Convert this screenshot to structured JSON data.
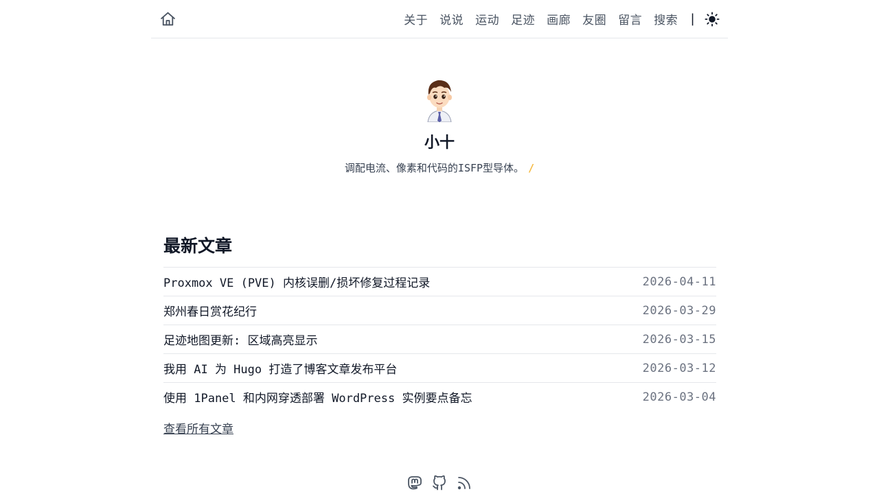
{
  "header": {
    "home_icon": "home-icon",
    "nav": [
      {
        "label": "关于"
      },
      {
        "label": "说说"
      },
      {
        "label": "运动"
      },
      {
        "label": "足迹"
      },
      {
        "label": "画廊"
      },
      {
        "label": "友圈"
      },
      {
        "label": "留言"
      },
      {
        "label": "搜索"
      }
    ],
    "separator": "|",
    "theme_icon": "sun-icon"
  },
  "profile": {
    "name": "小十",
    "bio": "调配电流、像素和代码的ISFP型导体。",
    "cursor": "/"
  },
  "posts": {
    "title": "最新文章",
    "items": [
      {
        "title": "Proxmox VE (PVE) 内核误删/损坏修复过程记录",
        "date": "2026-04-11"
      },
      {
        "title": "郑州春日赏花纪行",
        "date": "2026-03-29"
      },
      {
        "title": "足迹地图更新: 区域高亮显示",
        "date": "2026-03-15"
      },
      {
        "title": "我用 AI 为 Hugo 打造了博客文章发布平台",
        "date": "2026-03-12"
      },
      {
        "title": "使用 1Panel 和内网穿透部署 WordPress 实例要点备忘",
        "date": "2026-03-04"
      }
    ],
    "all_link": "查看所有文章"
  },
  "footer": {
    "icons": [
      "mastodon-icon",
      "github-icon",
      "rss-icon"
    ]
  },
  "colors": {
    "accent_cursor": "#f5b83d",
    "text": "#111827",
    "muted": "#6b7280",
    "border": "#e5e7eb"
  }
}
